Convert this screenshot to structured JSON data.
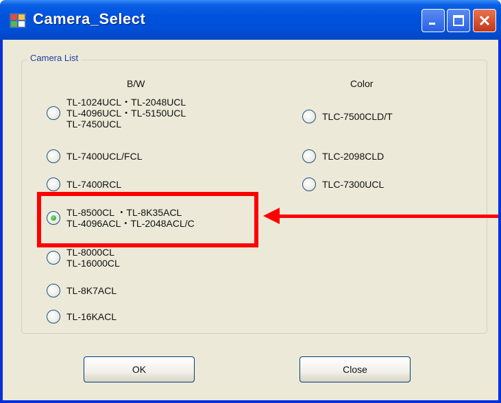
{
  "window": {
    "title": "Camera_Select"
  },
  "group": {
    "legend": "Camera List"
  },
  "columns": {
    "bw": "B/W",
    "color": "Color"
  },
  "bw_items": [
    {
      "label": "TL-1024UCL・TL-2048UCL\nTL-4096UCL・TL-5150UCL\nTL-7450UCL",
      "checked": false
    },
    {
      "label": "TL-7400UCL/FCL",
      "checked": false
    },
    {
      "label": "TL-7400RCL",
      "checked": false
    },
    {
      "label": "TL-8500CL ・TL-8K35ACL\nTL-4096ACL・TL-2048ACL/C",
      "checked": true
    },
    {
      "label": "TL-8000CL\nTL-16000CL",
      "checked": false
    },
    {
      "label": "TL-8K7ACL",
      "checked": false
    },
    {
      "label": "TL-16KACL",
      "checked": false
    }
  ],
  "color_items": [
    {
      "label": "TLC-7500CLD/T",
      "checked": false
    },
    {
      "label": "TLC-2098CLD",
      "checked": false
    },
    {
      "label": "TLC-7300UCL",
      "checked": false
    }
  ],
  "buttons": {
    "ok": "OK",
    "close": "Close"
  },
  "annotation_color": "#ff0000"
}
